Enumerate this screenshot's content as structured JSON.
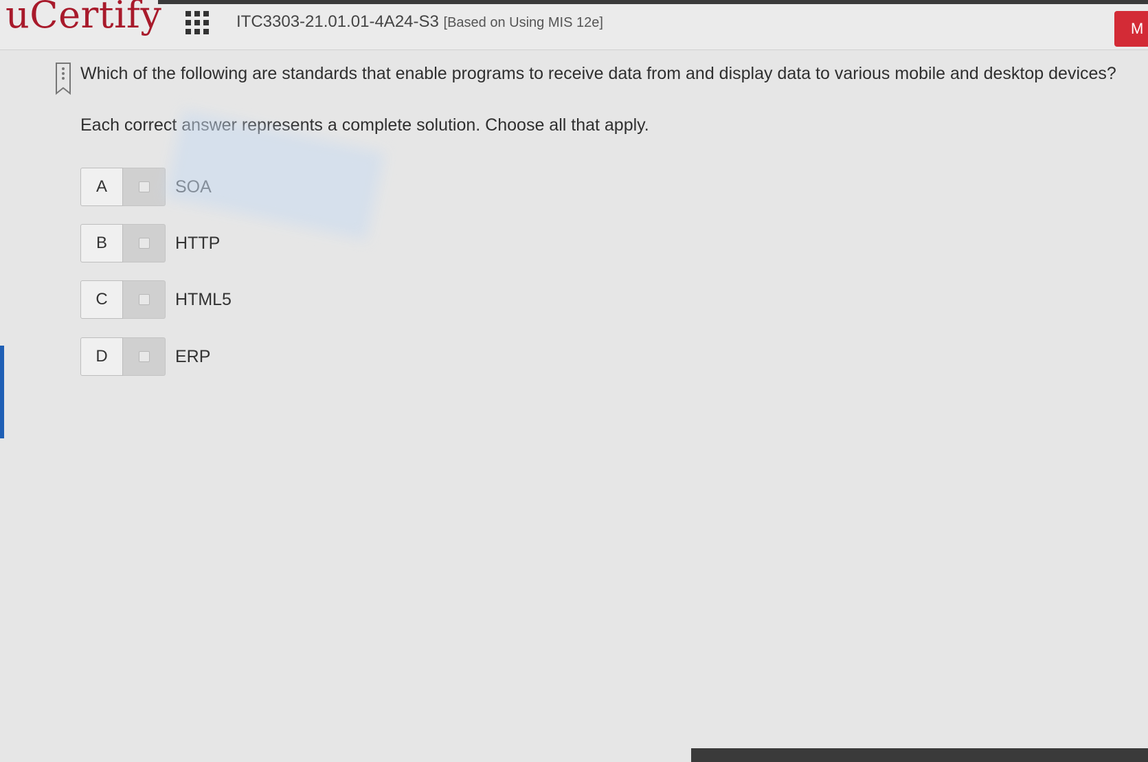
{
  "header": {
    "logo_text": "uCertify",
    "apps_icon": "grid-apps-icon",
    "course_code": "ITC3303-21.01.01-4A24-S3",
    "course_sub": "[Based on Using MIS 12e]",
    "right_button_label": "M",
    "accent_color": "#d32b36"
  },
  "question": {
    "bookmark_icon": "bookmark-icon",
    "text": "Which of the following are standards that enable programs to receive data from and display data to various mobile and desktop devices?",
    "instruction": "Each correct answer represents a complete solution. Choose all that apply."
  },
  "options": [
    {
      "letter": "A",
      "label": "SOA",
      "checked": false
    },
    {
      "letter": "B",
      "label": "HTTP",
      "checked": false
    },
    {
      "letter": "C",
      "label": "HTML5",
      "checked": false
    },
    {
      "letter": "D",
      "label": "ERP",
      "checked": false
    }
  ]
}
